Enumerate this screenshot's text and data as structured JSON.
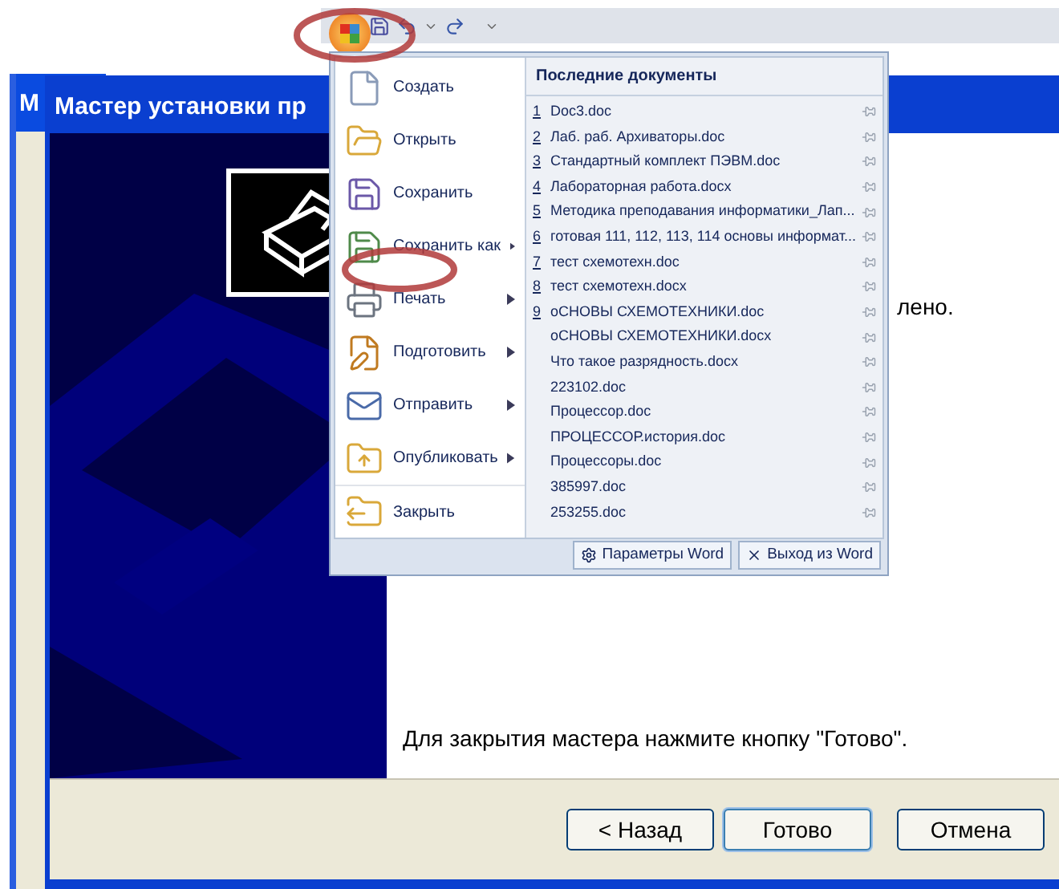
{
  "background_window": {
    "title": "М"
  },
  "wizard": {
    "title": "Мастер установки пр",
    "partial_text": "лено.",
    "finish_text": "Для закрытия мастера нажмите кнопку \"Готово\".",
    "buttons": [
      {
        "label": "< Назад",
        "default": false
      },
      {
        "label": "Готово",
        "default": true
      },
      {
        "label": "Отмена",
        "default": false
      }
    ]
  },
  "office_menu": {
    "commands": [
      {
        "label": "Создать",
        "submenu": false
      },
      {
        "label": "Открыть",
        "submenu": false
      },
      {
        "label": "Сохранить",
        "submenu": false
      },
      {
        "label": "Сохранить как",
        "submenu": true
      },
      {
        "label": "Печать",
        "submenu": true
      },
      {
        "label": "Подготовить",
        "submenu": true
      },
      {
        "label": "Отправить",
        "submenu": true
      },
      {
        "label": "Опубликовать",
        "submenu": true
      },
      {
        "label": "Закрыть",
        "submenu": false
      }
    ],
    "recent_title": "Последние документы",
    "recent": [
      {
        "number": "1",
        "name": "Doc3.doc"
      },
      {
        "number": "2",
        "name": "Лаб. раб. Архиваторы.doc"
      },
      {
        "number": "3",
        "name": "Стандартный комплект ПЭВМ.doc"
      },
      {
        "number": "4",
        "name": "Лабораторная работа.docx"
      },
      {
        "number": "5",
        "name": "Методика преподавания информатики_Лап..."
      },
      {
        "number": "6",
        "name": "готовая 111, 112, 113, 114 основы информат..."
      },
      {
        "number": "7",
        "name": "тест схемотехн.doc"
      },
      {
        "number": "8",
        "name": "тест схемотехн.docx"
      },
      {
        "number": "9",
        "name": "оСНОВЫ СХЕМОТЕХНИКИ.doc"
      },
      {
        "name": "оСНОВЫ СХЕМОТЕХНИКИ.docx"
      },
      {
        "name": "Что такое разрядность.docx"
      },
      {
        "name": "223102.doc"
      },
      {
        "name": "Процессор.doc"
      },
      {
        "name": "ПРОЦЕССОР.история.doc"
      },
      {
        "name": "Процессоры.doc"
      },
      {
        "name": "385997.doc"
      },
      {
        "name": "253255.doc"
      }
    ],
    "footer_buttons": [
      "Параметры Word",
      "Выход из Word"
    ]
  }
}
